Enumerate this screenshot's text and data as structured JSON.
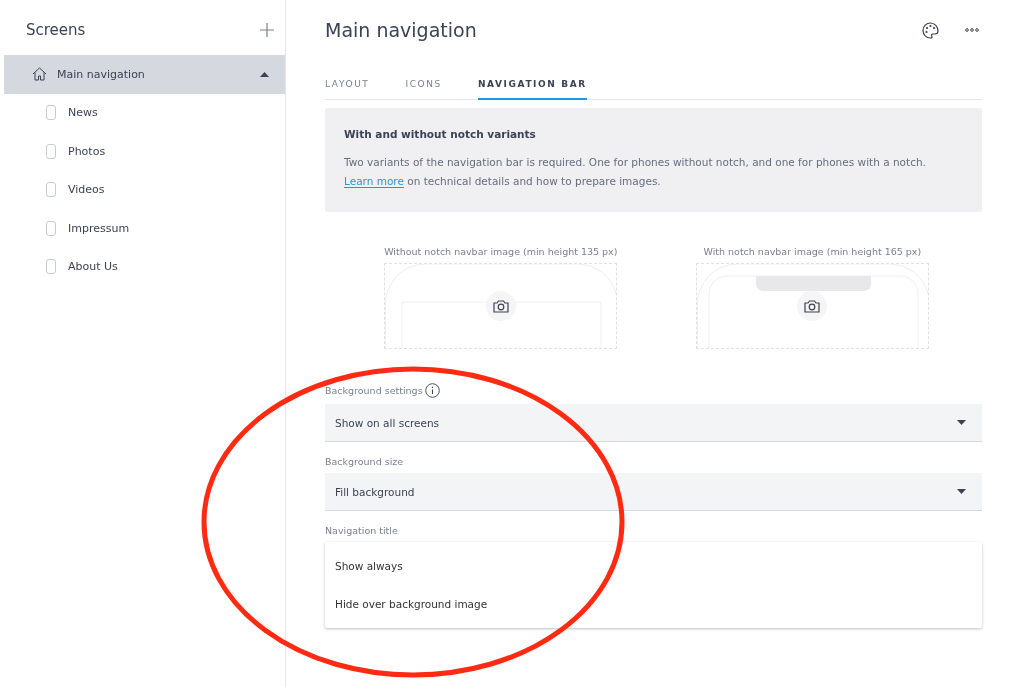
{
  "sidebar": {
    "title": "Screens",
    "items": [
      {
        "label": "Main navigation",
        "kind": "home",
        "selected": true,
        "expanded": true,
        "children": [
          {
            "label": "News",
            "kind": "page",
            "selected": false
          },
          {
            "label": "Photos",
            "kind": "page",
            "selected": false
          },
          {
            "label": "Videos",
            "kind": "page",
            "selected": false
          },
          {
            "label": "Impressum",
            "kind": "page",
            "selected": false
          },
          {
            "label": "About Us",
            "kind": "page",
            "selected": false
          }
        ]
      }
    ]
  },
  "header": {
    "title": "Main navigation"
  },
  "tabs": [
    {
      "label": "LAYOUT",
      "selected": false
    },
    {
      "label": "ICONS",
      "selected": false
    },
    {
      "label": "NAVIGATION BAR",
      "selected": true
    }
  ],
  "info": {
    "title": "With and without notch variants",
    "text": "Two variants of the navigation bar is required. One for phones without notch, and one for phones with a notch.",
    "link": "Learn more",
    "text_after": "on technical details and how to prepare images."
  },
  "uploads": [
    {
      "label": "Without notch navbar image (min height 135 px)",
      "kind": "plain"
    },
    {
      "label": "With notch navbar image (min height 165 px)",
      "kind": "notch"
    }
  ],
  "fields": [
    {
      "label": "Background settings",
      "info": true,
      "kind": "select",
      "value": "Show on all screens"
    },
    {
      "label": "Background size",
      "info": false,
      "kind": "select",
      "value": "Fill background"
    },
    {
      "label": "Navigation title",
      "info": false,
      "kind": "menu",
      "options": [
        "Show always",
        "Hide over background image"
      ]
    }
  ],
  "annotation": {
    "kind": "ellipse",
    "color": "#ff2a12"
  }
}
